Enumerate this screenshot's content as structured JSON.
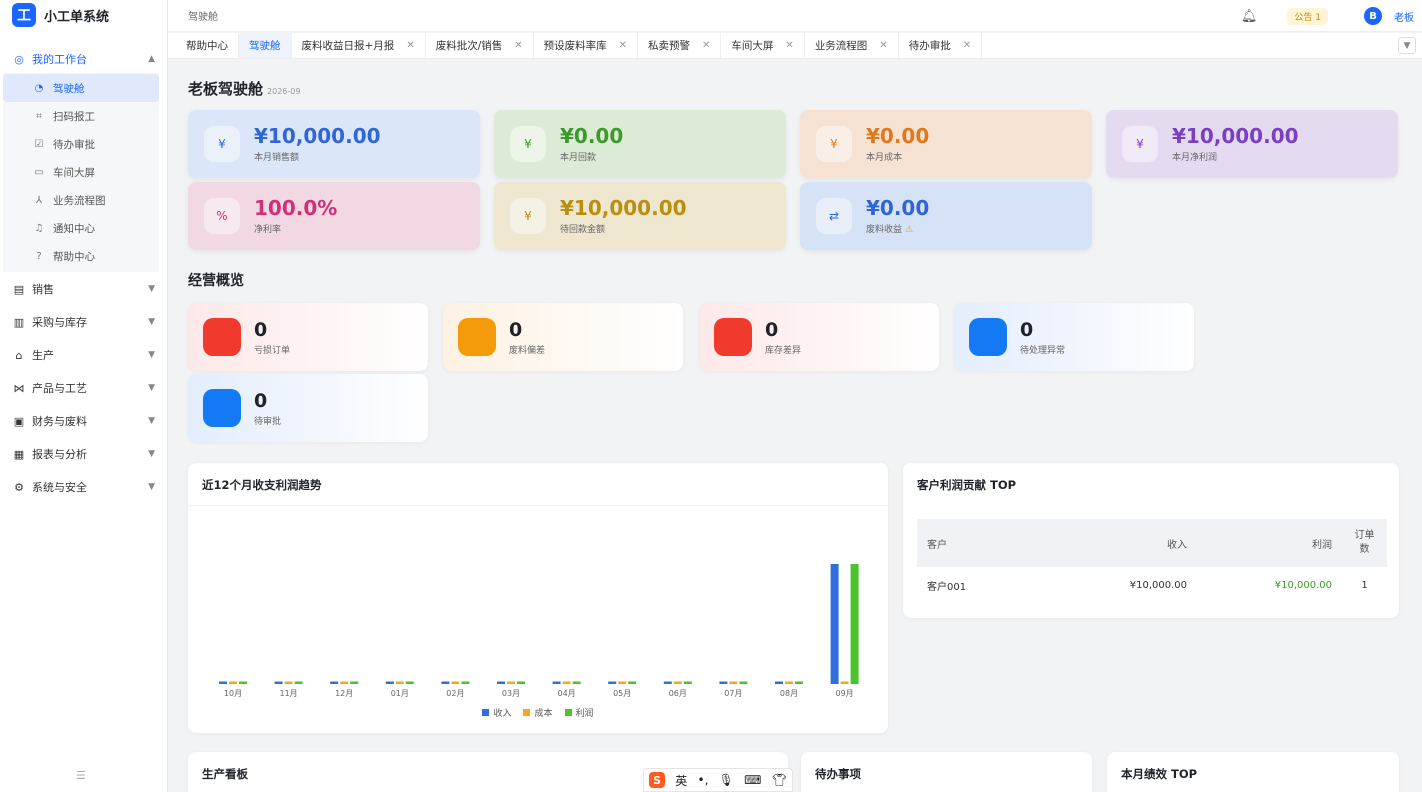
{
  "app": {
    "name": "小工单系统",
    "logo": "工"
  },
  "sidebar": {
    "groups": [
      {
        "label": "我的工作台",
        "icon": "dashboard-icon",
        "active": true
      },
      {
        "label": "销售",
        "icon": "sales-icon"
      },
      {
        "label": "采购与库存",
        "icon": "inventory-icon"
      },
      {
        "label": "生产",
        "icon": "production-icon"
      },
      {
        "label": "产品与工艺",
        "icon": "product-icon"
      },
      {
        "label": "财务与废料",
        "icon": "finance-icon"
      },
      {
        "label": "报表与分析",
        "icon": "report-icon"
      },
      {
        "label": "系统与安全",
        "icon": "settings-icon"
      }
    ],
    "workbench_items": [
      {
        "label": "驾驶舱",
        "icon": "cockpit-icon",
        "active": true
      },
      {
        "label": "扫码报工",
        "icon": "scan-icon"
      },
      {
        "label": "待办审批",
        "icon": "approval-icon"
      },
      {
        "label": "车间大屏",
        "icon": "monitor-icon"
      },
      {
        "label": "业务流程图",
        "icon": "flowchart-icon"
      },
      {
        "label": "通知中心",
        "icon": "bell-icon"
      },
      {
        "label": "帮助中心",
        "icon": "help-icon"
      }
    ]
  },
  "topbar": {
    "breadcrumb": "驾驶舱",
    "notice": "公告 1",
    "avatar": "B",
    "user": "老板"
  },
  "tabs": [
    {
      "label": "帮助中心",
      "closable": false
    },
    {
      "label": "驾驶舱",
      "closable": false,
      "active": true
    },
    {
      "label": "废料收益日报+月报",
      "closable": true
    },
    {
      "label": "废料批次/销售",
      "closable": true
    },
    {
      "label": "预设废料率库",
      "closable": true
    },
    {
      "label": "私卖预警",
      "closable": true
    },
    {
      "label": "车间大屏",
      "closable": true
    },
    {
      "label": "业务流程图",
      "closable": true
    },
    {
      "label": "待办审批",
      "closable": true
    }
  ],
  "page": {
    "title": "老板驾驶舱",
    "date": "2026-09"
  },
  "kpis": [
    {
      "value": "¥10,000.00",
      "label": "本月销售额",
      "color": "#2f66d6",
      "bg": "#dbe6f8",
      "icon": "¥"
    },
    {
      "value": "¥0.00",
      "label": "本月回款",
      "color": "#3b9a2a",
      "bg": "#dcebd6",
      "icon": "¥"
    },
    {
      "value": "¥0.00",
      "label": "本月成本",
      "color": "#e0781c",
      "bg": "#f6e2d2",
      "icon": "¥"
    },
    {
      "value": "¥10,000.00",
      "label": "本月净利润",
      "color": "#7a3fc2",
      "bg": "#e5dbf1",
      "icon": "¥"
    },
    {
      "value": "100.0%",
      "label": "净利率",
      "color": "#d0307a",
      "bg": "#f1d8e3",
      "icon": "%"
    },
    {
      "value": "¥10,000.00",
      "label": "待回款金额",
      "color": "#b7900f",
      "bg": "#efe6cf",
      "icon": "¥"
    },
    {
      "value": "¥0.00",
      "label": "废料收益",
      "color": "#2f66d6",
      "bg": "#d6e2f5",
      "icon": "⇄",
      "warn": "⚠"
    }
  ],
  "overview": {
    "title": "经营概览",
    "items": [
      {
        "value": "0",
        "label": "亏损订单",
        "color": "#f03a2e",
        "bg": "#fde8e8"
      },
      {
        "value": "0",
        "label": "废料偏差",
        "color": "#f59a0a",
        "bg": "#fdf1e2"
      },
      {
        "value": "0",
        "label": "库存差异",
        "color": "#f03a2e",
        "bg": "#fde8e8"
      },
      {
        "value": "0",
        "label": "待处理异常",
        "color": "#1479f5",
        "bg": "#e3edfc"
      },
      {
        "value": "0",
        "label": "待审批",
        "color": "#1479f5",
        "bg": "#e3edfc"
      }
    ]
  },
  "trend_card": {
    "title": "近12个月收支利润趋势"
  },
  "chart_data": {
    "type": "bar",
    "categories": [
      "10月",
      "11月",
      "12月",
      "01月",
      "02月",
      "03月",
      "04月",
      "05月",
      "06月",
      "07月",
      "08月",
      "09月"
    ],
    "series": [
      {
        "name": "收入",
        "color": "#2f6fe0",
        "values": [
          0,
          0,
          0,
          0,
          0,
          0,
          0,
          0,
          0,
          0,
          0,
          10000
        ]
      },
      {
        "name": "成本",
        "color": "#f5a623",
        "values": [
          0,
          0,
          0,
          0,
          0,
          0,
          0,
          0,
          0,
          0,
          0,
          0
        ]
      },
      {
        "name": "利润",
        "color": "#4cc22e",
        "values": [
          0,
          0,
          0,
          0,
          0,
          0,
          0,
          0,
          0,
          0,
          0,
          10000
        ]
      }
    ],
    "ylim": [
      0,
      10000
    ],
    "grid": false,
    "legend": "bottom"
  },
  "customer_card": {
    "title": "客户利润贡献 TOP",
    "headers": {
      "customer": "客户",
      "revenue": "收入",
      "profit": "利润",
      "orders": "订单数"
    },
    "rows": [
      {
        "customer": "客户001",
        "revenue": "¥10,000.00",
        "profit": "¥10,000.00",
        "orders": "1"
      }
    ]
  },
  "bottom_cards": {
    "production": "生产看板",
    "todo": "待办事项",
    "performance": "本月绩效 TOP"
  },
  "ime": {
    "lang": "英"
  }
}
